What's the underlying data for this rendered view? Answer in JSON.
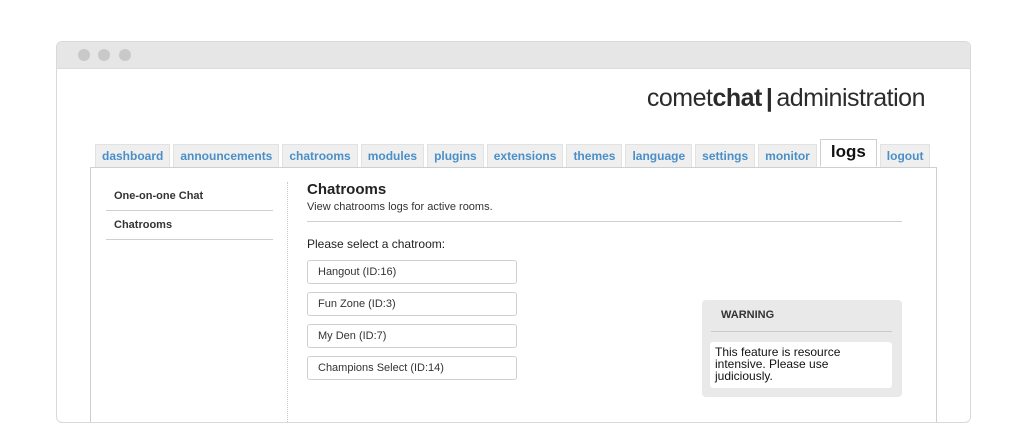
{
  "brand": {
    "part1": "comet",
    "part2": "chat",
    "separator": "|",
    "part3": "administration"
  },
  "tabs": [
    {
      "label": "dashboard",
      "active": false
    },
    {
      "label": "announcements",
      "active": false
    },
    {
      "label": "chatrooms",
      "active": false
    },
    {
      "label": "modules",
      "active": false
    },
    {
      "label": "plugins",
      "active": false
    },
    {
      "label": "extensions",
      "active": false
    },
    {
      "label": "themes",
      "active": false
    },
    {
      "label": "language",
      "active": false
    },
    {
      "label": "settings",
      "active": false
    },
    {
      "label": "monitor",
      "active": false
    },
    {
      "label": "logs",
      "active": true
    },
    {
      "label": "logout",
      "active": false
    }
  ],
  "sidebar": {
    "items": [
      {
        "label": "One-on-one Chat"
      },
      {
        "label": "Chatrooms"
      }
    ]
  },
  "main": {
    "title": "Chatrooms",
    "subtitle": "View chatrooms logs for active rooms.",
    "prompt": "Please select a chatroom:",
    "rooms": [
      {
        "label": "Hangout  (ID:16)"
      },
      {
        "label": "Fun Zone  (ID:3)"
      },
      {
        "label": "My Den  (ID:7)"
      },
      {
        "label": "Champions Select  (ID:14)"
      }
    ]
  },
  "warning": {
    "title": "WARNING",
    "body": "This feature is resource intensive. Please use judiciously."
  },
  "colors": {
    "tab_link": "#4a8fc7",
    "window_bar": "#e6e6e6",
    "warning_bg": "#e9e9e9"
  }
}
